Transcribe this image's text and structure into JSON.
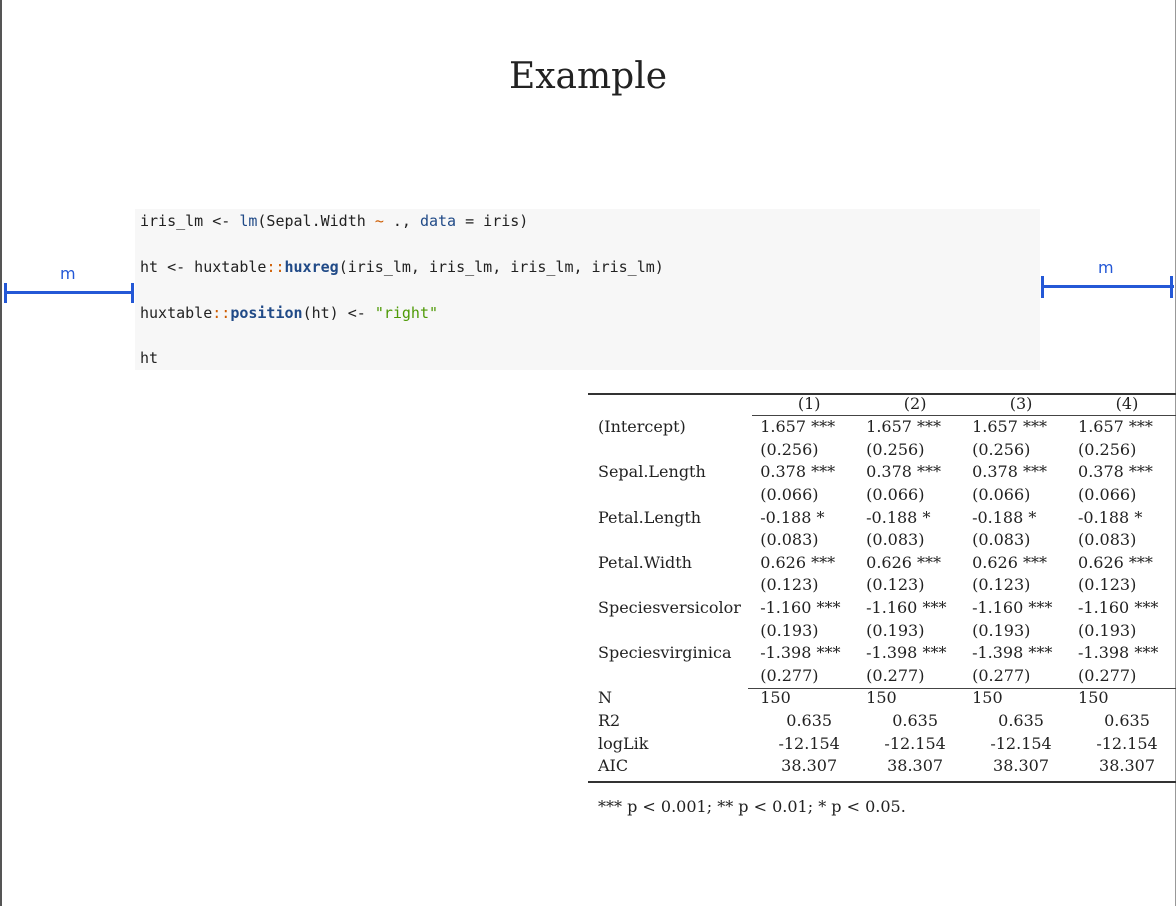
{
  "title": "Example",
  "code": {
    "line1": {
      "a": "iris_lm <- ",
      "fn": "lm",
      "b": "(Sepal.Width ",
      "tilde": "~",
      "c": " ., ",
      "arg": "data",
      "d": " = iris)"
    },
    "line2": {
      "a": "ht <- huxtable",
      "ns": "::",
      "fn": "huxreg",
      "b": "(iris_lm, iris_lm, iris_lm, iris_lm)"
    },
    "line3": {
      "a": "huxtable",
      "ns": "::",
      "fn": "position",
      "b": "(ht) <- ",
      "str": "\"right\""
    },
    "line4": {
      "a": "ht"
    }
  },
  "margin_markers": {
    "left_label": "m",
    "right_label": "m"
  },
  "table": {
    "headers": [
      "(1)",
      "(2)",
      "(3)",
      "(4)"
    ],
    "rows": [
      {
        "label": "(Intercept)",
        "values": [
          "1.657 ***",
          "1.657 ***",
          "1.657 ***",
          "1.657 ***"
        ]
      },
      {
        "label": "",
        "values": [
          "(0.256)",
          "(0.256)",
          "(0.256)",
          "(0.256)"
        ]
      },
      {
        "label": "Sepal.Length",
        "values": [
          "0.378 ***",
          "0.378 ***",
          "0.378 ***",
          "0.378 ***"
        ]
      },
      {
        "label": "",
        "values": [
          "(0.066)",
          "(0.066)",
          "(0.066)",
          "(0.066)"
        ]
      },
      {
        "label": "Petal.Length",
        "values": [
          "-0.188 *",
          "-0.188 *",
          "-0.188 *",
          "-0.188 *"
        ]
      },
      {
        "label": "",
        "values": [
          "(0.083)",
          "(0.083)",
          "(0.083)",
          "(0.083)"
        ]
      },
      {
        "label": "Petal.Width",
        "values": [
          "0.626 ***",
          "0.626 ***",
          "0.626 ***",
          "0.626 ***"
        ]
      },
      {
        "label": "",
        "values": [
          "(0.123)",
          "(0.123)",
          "(0.123)",
          "(0.123)"
        ]
      },
      {
        "label": "Speciesversicolor",
        "values": [
          "-1.160 ***",
          "-1.160 ***",
          "-1.160 ***",
          "-1.160 ***"
        ]
      },
      {
        "label": "",
        "values": [
          "(0.193)",
          "(0.193)",
          "(0.193)",
          "(0.193)"
        ]
      },
      {
        "label": "Speciesvirginica",
        "values": [
          "-1.398 ***",
          "-1.398 ***",
          "-1.398 ***",
          "-1.398 ***"
        ]
      },
      {
        "label": "",
        "values": [
          "(0.277)",
          "(0.277)",
          "(0.277)",
          "(0.277)"
        ]
      }
    ],
    "stats": [
      {
        "label": "N",
        "values": [
          "150",
          "150",
          "150",
          "150"
        ]
      },
      {
        "label": "R2",
        "values": [
          "0.635",
          "0.635",
          "0.635",
          "0.635"
        ]
      },
      {
        "label": "logLik",
        "values": [
          "-12.154",
          "-12.154",
          "-12.154",
          "-12.154"
        ]
      },
      {
        "label": "AIC",
        "values": [
          "38.307",
          "38.307",
          "38.307",
          "38.307"
        ]
      }
    ],
    "note": "*** p < 0.001; ** p < 0.01; * p < 0.05."
  }
}
